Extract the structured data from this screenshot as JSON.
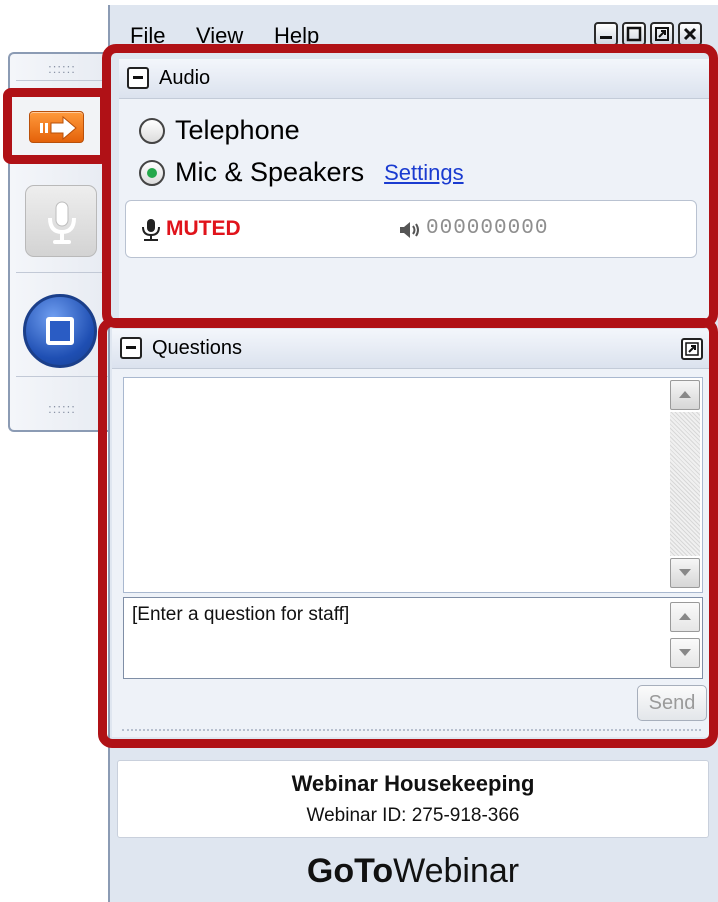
{
  "menu": {
    "file": "File",
    "view": "View",
    "help": "Help"
  },
  "window_controls": [
    "minimize-icon",
    "maximize-icon",
    "popout-icon",
    "close-icon"
  ],
  "audio": {
    "title": "Audio",
    "options": [
      {
        "label": "Telephone",
        "selected": false
      },
      {
        "label": "Mic & Speakers",
        "selected": true
      }
    ],
    "settings_link": "Settings",
    "mic_status": "MUTED",
    "speaker_level": "000000000"
  },
  "questions": {
    "title": "Questions",
    "input_placeholder": "[Enter a question for staff]",
    "send_label": "Send"
  },
  "webinar": {
    "title": "Webinar Housekeeping",
    "id_line": "Webinar ID: 275-918-366"
  },
  "brand": {
    "bold": "GoTo",
    "regular": "Webinar"
  },
  "colors": {
    "highlight_frame": "#b01116",
    "muted_text": "#e0131b",
    "accent_orange": "#f07a1e",
    "link_blue": "#1a3bd0"
  }
}
